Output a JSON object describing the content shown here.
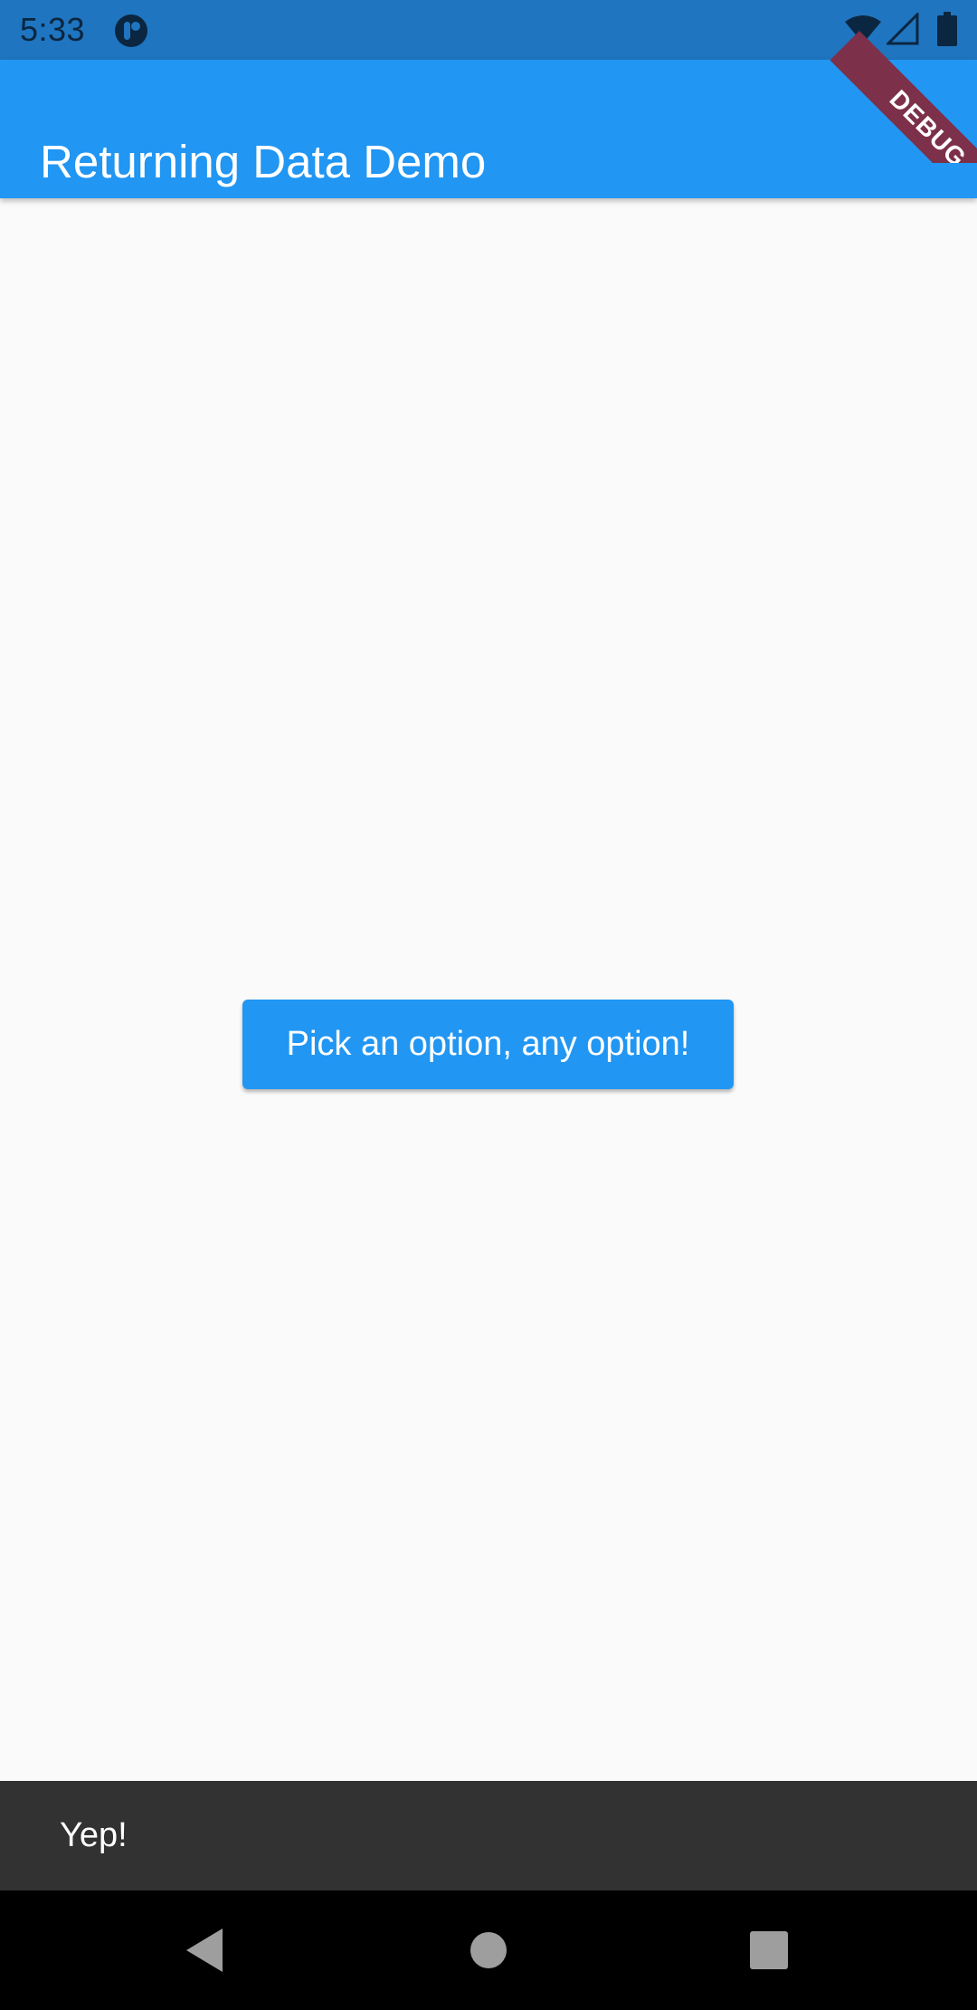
{
  "status_bar": {
    "time": "5:33",
    "icons": [
      "app-notification-icon",
      "wifi-icon",
      "signal-icon",
      "battery-icon"
    ]
  },
  "app_bar": {
    "title": "Returning Data Demo",
    "color": "#2196f3"
  },
  "debug_banner": {
    "label": "DEBUG",
    "color": "#7c3049"
  },
  "main": {
    "button_label": "Pick an option, any option!"
  },
  "snackbar": {
    "message": "Yep!"
  },
  "nav_bar": {
    "icons": [
      "back-icon",
      "home-icon",
      "recents-icon"
    ]
  }
}
